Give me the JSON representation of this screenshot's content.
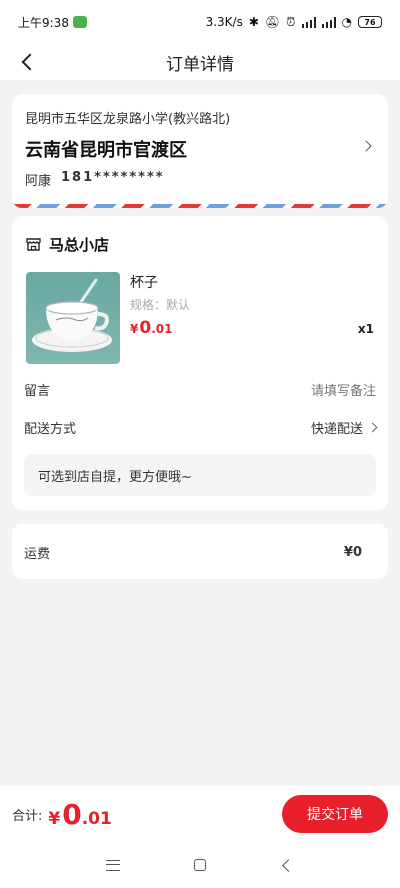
{
  "status_bar": {
    "time": "上午9:38",
    "network_speed": "3.3K/s",
    "battery": "76",
    "icons": [
      "app-badge-icon",
      "bluetooth-icon",
      "mute-icon",
      "alarm-icon",
      "hd-signal-icon",
      "hd-signal-icon",
      "wifi-icon",
      "battery-icon"
    ]
  },
  "nav": {
    "title": "订单详情",
    "back_icon": "chevron-left-icon"
  },
  "address": {
    "detail": "昆明市五华区龙泉路小学(教兴路北)",
    "region": "云南省昆明市官渡区",
    "name": "阿康",
    "phone": "181********"
  },
  "shop": {
    "icon": "store-icon",
    "name": "马总小店",
    "product": {
      "name": "杯子",
      "spec": "规格：默认",
      "price_symbol": "¥",
      "price_int": "0",
      "price_dec": ".01",
      "quantity": "x1"
    },
    "message_label": "留言",
    "message_placeholder": "请填写备注",
    "delivery_label": "配送方式",
    "delivery_value": "快递配送",
    "pickup_tip": "可选到店自提，更方便哦~"
  },
  "shipping": {
    "label": "运费",
    "value": "¥0"
  },
  "bottom_bar": {
    "total_label": "合计:",
    "total_symbol": "¥",
    "total_int": "0",
    "total_dec": ".01",
    "submit_label": "提交订单"
  },
  "system_nav": {
    "icons": [
      "menu-icon",
      "home-icon",
      "back-icon"
    ]
  },
  "colors": {
    "accent": "#e8202b",
    "background": "#f3f3f3",
    "airmail_red": "#e53935",
    "airmail_blue": "#6f9fe0"
  }
}
